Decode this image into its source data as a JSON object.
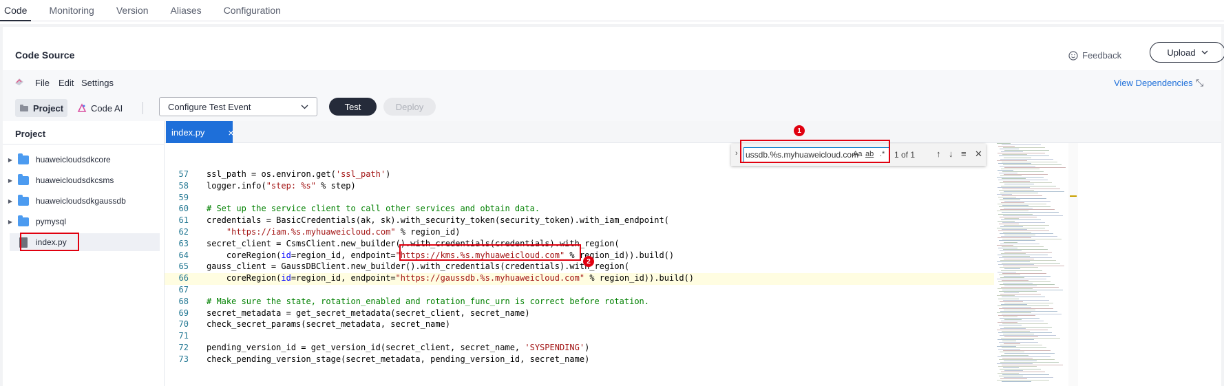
{
  "top_tabs": [
    "Code",
    "Monitoring",
    "Version",
    "Aliases",
    "Configuration"
  ],
  "card": {
    "title": "Code Source",
    "feedback": "Feedback",
    "upload": "Upload"
  },
  "menu": {
    "file": "File",
    "edit": "Edit",
    "settings": "Settings",
    "view_dependencies": "View Dependencies"
  },
  "toolbar": {
    "project": "Project",
    "code_ai": "Code AI",
    "test_event": "Configure Test Event",
    "test": "Test",
    "deploy": "Deploy"
  },
  "sidebar": {
    "title": "Project",
    "items": [
      "huaweicloudsdkcore",
      "huaweicloudsdkcsms",
      "huaweicloudsdkgaussdb",
      "pymysql",
      "index.py"
    ]
  },
  "editor": {
    "tab": "index.py",
    "current_line": 66
  },
  "code_lines": [
    {
      "n": "57",
      "t": "    ssl_path = os.environ.get('ssl_path')"
    },
    {
      "n": "58",
      "t": "    logger.info(\"step: %s\" % step)"
    },
    {
      "n": "59",
      "t": ""
    },
    {
      "n": "60",
      "t": "    # Set up the service client to call other services and obtain data."
    },
    {
      "n": "61",
      "t": "    credentials = BasicCredentials(ak, sk).with_security_token(security_token).with_iam_endpoint("
    },
    {
      "n": "62",
      "t": "        \"https://iam.%s.myhuaweicloud.com\" % region_id)"
    },
    {
      "n": "63",
      "t": "    secret_client = CsmsClient.new_builder().with_credentials(credentials).with_region("
    },
    {
      "n": "64",
      "t": "        coreRegion(id=region_id, endpoint=\"https://kms.%s.myhuaweicloud.com\" % region_id)).build()"
    },
    {
      "n": "65",
      "t": "    gauss_client = GaussDBClient.new_builder().with_credentials(credentials).with_region("
    },
    {
      "n": "66",
      "t": "        coreRegion(id=region_id, endpoint=\"https://gaussdb.%s.myhuaweicloud.com\" % region_id)).build()"
    },
    {
      "n": "67",
      "t": ""
    },
    {
      "n": "68",
      "t": "    # Make sure the state, rotation_enabled and rotation_func_urn is correct before rotation."
    },
    {
      "n": "69",
      "t": "    secret_metadata = get_secret_metadata(secret_client, secret_name)"
    },
    {
      "n": "70",
      "t": "    check_secret_params(secret_metadata, secret_name)"
    },
    {
      "n": "71",
      "t": ""
    },
    {
      "n": "72",
      "t": "    pending_version_id = get_version_id(secret_client, secret_name, 'SYSPENDING')"
    },
    {
      "n": "73",
      "t": "    check_pending_version_stage(secret_metadata, pending_version_id, secret_name)"
    }
  ],
  "find": {
    "value": "ussdb.%s.myhuaweicloud.com",
    "match_case": "Aa",
    "whole_word": "ab",
    "regex": ".*",
    "count": "1 of 1"
  },
  "badges": {
    "one": "1",
    "two": "2"
  },
  "colors": {
    "accent": "#1e6fd9",
    "annotation": "#e0000f",
    "dark_button": "#252b3a"
  }
}
